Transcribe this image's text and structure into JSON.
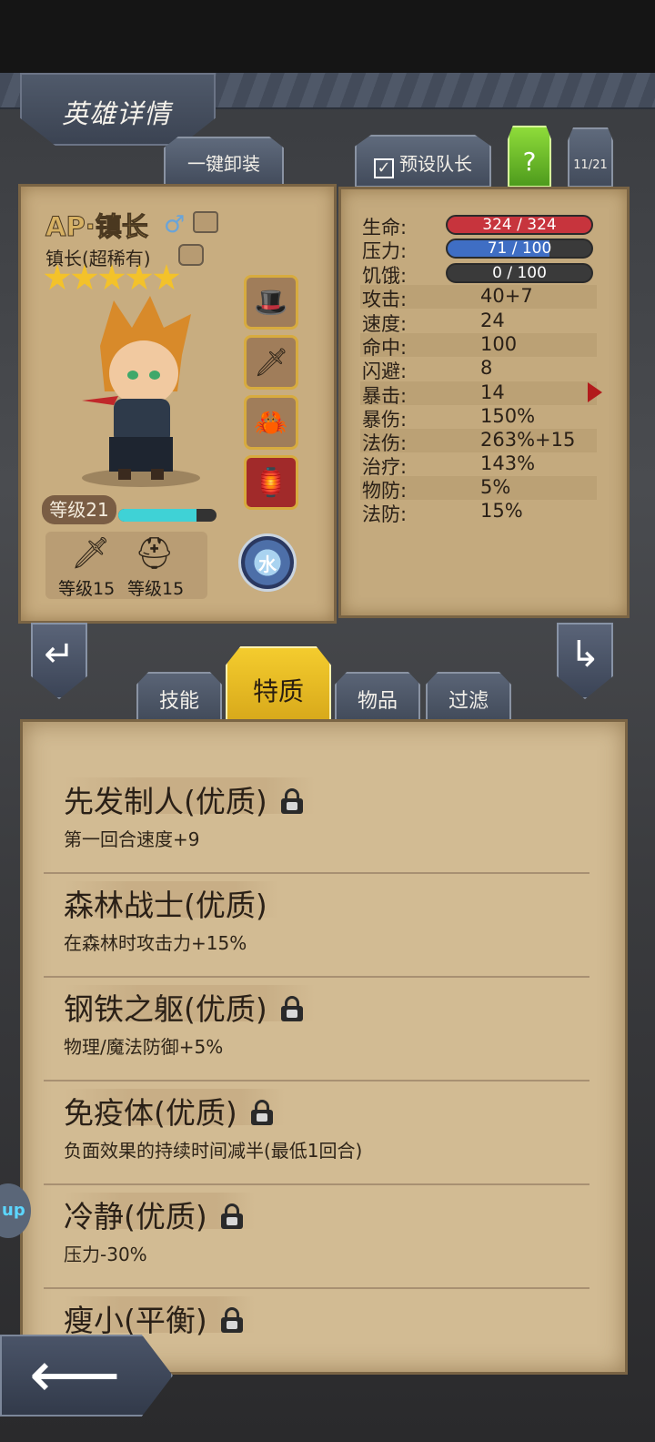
{
  "screen_title": "英雄详情",
  "unequip_all_label": "一键卸装",
  "preset_captain": {
    "checked": true,
    "label": "预设队长"
  },
  "help_label": "?",
  "hero_index": "11/21",
  "hero": {
    "name": "AP·镇长",
    "class": "镇长(超稀有)",
    "stars": 5,
    "level_label": "等级21",
    "level_progress": 0.8,
    "weapon_level_label": "等级15",
    "armor_level_label": "等级15",
    "element_label": "水",
    "equipment": [
      "wizard-hat",
      "sword",
      "crab-claw",
      "lantern"
    ]
  },
  "stats": {
    "hp": {
      "label": "生命:",
      "value": "324 / 324"
    },
    "stress": {
      "label": "压力:",
      "value": "71 / 100"
    },
    "hunger": {
      "label": "饥饿:",
      "value": "0 / 100"
    },
    "rows": [
      {
        "label": "攻击:",
        "value": "40+7"
      },
      {
        "label": "速度:",
        "value": "24"
      },
      {
        "label": "命中:",
        "value": "100"
      },
      {
        "label": "闪避:",
        "value": "8"
      },
      {
        "label": "暴击:",
        "value": "14"
      },
      {
        "label": "暴伤:",
        "value": "150%"
      },
      {
        "label": "法伤:",
        "value": "263%+15"
      },
      {
        "label": "治疗:",
        "value": "143%"
      },
      {
        "label": "物防:",
        "value": "5%"
      },
      {
        "label": "法防:",
        "value": "15%"
      }
    ]
  },
  "tabs": [
    {
      "label": "技能"
    },
    {
      "label": "特质",
      "active": true
    },
    {
      "label": "物品"
    },
    {
      "label": "过滤"
    }
  ],
  "traits": [
    {
      "name": "先发制人(优质)",
      "locked": true,
      "desc": "第一回合速度+9"
    },
    {
      "name": "森林战士(优质)",
      "locked": false,
      "desc": "在森林时攻击力+15%"
    },
    {
      "name": "钢铁之躯(优质)",
      "locked": true,
      "desc": "物理/魔法防御+5%"
    },
    {
      "name": "免疫体(优质)",
      "locked": true,
      "desc": "负面效果的持续时间减半(最低1回合)"
    },
    {
      "name": "冷静(优质)",
      "locked": true,
      "desc": "压力-30%"
    },
    {
      "name": "瘦小(平衡)",
      "locked": true,
      "desc": ""
    }
  ],
  "side_badge": "up",
  "colors": {
    "hp": "#c7343d",
    "stress": "#3f6ec4",
    "hunger": "#3a3a3a",
    "active_tab": "#f4cc2e",
    "level_bar": "#3fd2d6"
  }
}
